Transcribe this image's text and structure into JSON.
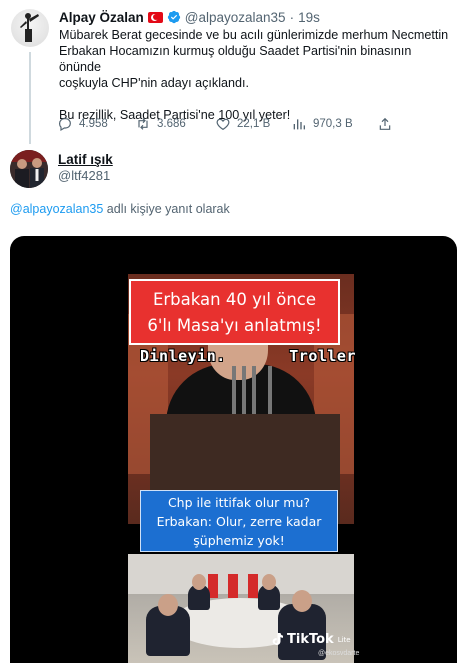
{
  "tweet": {
    "author_name": "Alpay Özalan",
    "handle": "@alpayozalan35",
    "dot": "·",
    "time": "19s",
    "text_lines": [
      "Mübarek Berat gecesinde ve bu acılı günlerimizde merhum Necmettin",
      "Erbakan Hocamızın kurmuş olduğu Saadet Partisi'nin binasının önünde",
      "coşkuyla CHP'nin adayı açıklandı."
    ],
    "text_line2": "Bu rezillik, Saadet Partisi'ne 100 yıl yeter!",
    "replies": "4.958",
    "retweets": "3.686",
    "likes": "22,1 B",
    "views": "970,3 B"
  },
  "reply": {
    "author_name": "Latif ışık",
    "handle": "@ltf4281",
    "replying_mention": "@alpayozalan35",
    "replying_suffix": " adlı kişiye yanıt olarak"
  },
  "video": {
    "caption_top_line1": "Erbakan 40 yıl önce",
    "caption_top_line2": "6'lı Masa'yı anlatmış!",
    "caption_mid_left": "Dinleyin.",
    "caption_mid_right": "Troller",
    "caption_q_line1": "Chp ile ittifak olur mu?",
    "caption_q_line2": "Erbakan: Olur, zerre kadar",
    "caption_q_line3": "şüphemiz yok!",
    "watermark": "TikTok",
    "watermark_badge": "Lite",
    "watermark_user": "@ekosvdarte"
  },
  "colors": {
    "accent": "#1d9bf0",
    "muted": "#536471",
    "caption_red": "#e8312f",
    "caption_blue": "#1c6fd1"
  }
}
